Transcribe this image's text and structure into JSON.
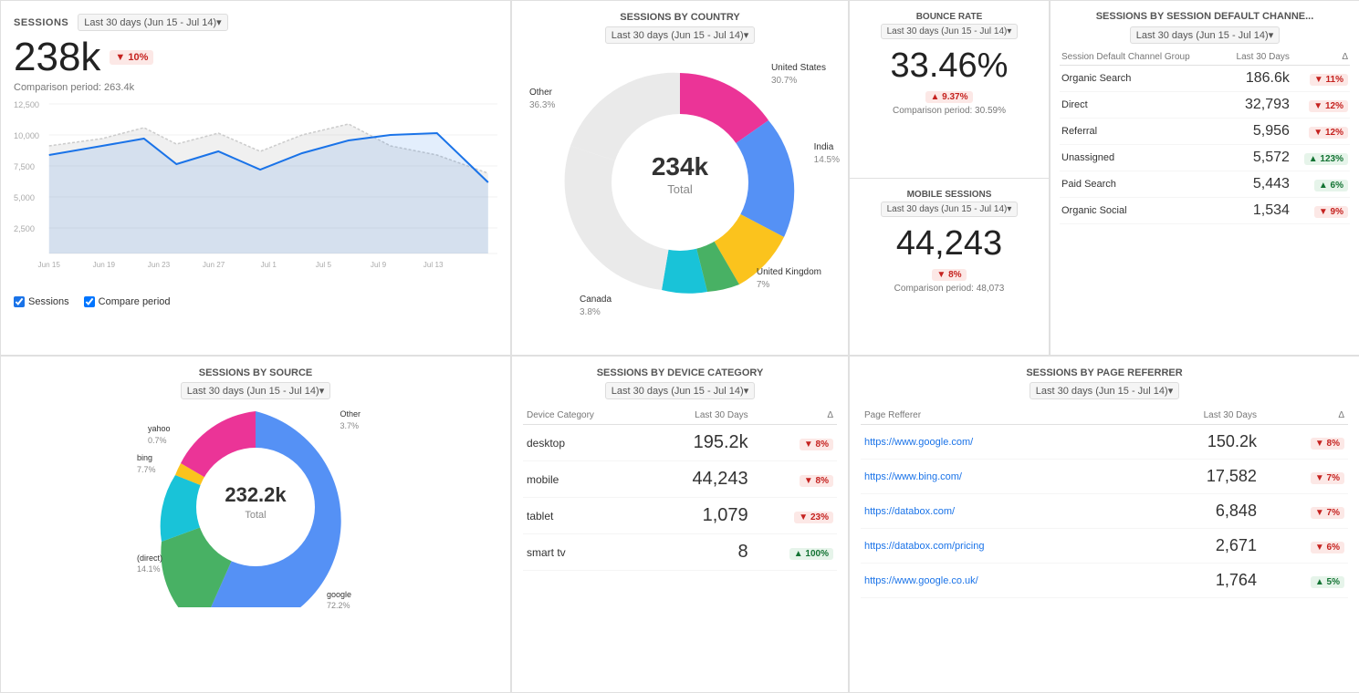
{
  "sessions": {
    "title": "SESSIONS",
    "dateFilter": "Last 30 days (Jun 15 - Jul 14)",
    "value": "238k",
    "changeBadge": "▼ 10%",
    "comparison": "Comparison period: 263.4k",
    "legend": {
      "sessions": "Sessions",
      "comparePeriod": "Compare period"
    },
    "yAxis": [
      "12,500",
      "10,000",
      "7,500",
      "5,000",
      "2,500"
    ],
    "xAxis": [
      "Jun 15",
      "Jun 19",
      "Jun 23",
      "Jun 27",
      "Jul 1",
      "Jul 5",
      "Jul 9",
      "Jul 13"
    ]
  },
  "sessionsByCountry": {
    "title": "SESSIONS BY COUNTRY",
    "dateFilter": "Last 30 days (Jun 15 - Jul 14)",
    "total": "234k",
    "totalLabel": "Total",
    "segments": [
      {
        "label": "United States",
        "value": "30.7%",
        "color": "#4285f4"
      },
      {
        "label": "India",
        "value": "14.5%",
        "color": "#34a853"
      },
      {
        "label": "United Kingdom",
        "value": "7%",
        "color": "#fbbc04"
      },
      {
        "label": "Canada",
        "value": "3.8%",
        "color": "#ea4335"
      },
      {
        "label": "Other",
        "value": "36.3%",
        "color": "#e91e8c"
      }
    ]
  },
  "bounceRate": {
    "title": "BOUNCE RATE",
    "dateFilter": "Last 30 days (Jun 15 - Jul 14)",
    "value": "33.46%",
    "changeBadge": "▲ 9.37%",
    "changeType": "up-bad",
    "comparison": "Comparison period: 30.59%"
  },
  "mobileSessions": {
    "title": "MOBILE SESSIONS",
    "dateFilter": "Last 30 days (Jun 15 - Jul 14)",
    "value": "44,243",
    "changeBadge": "▼ 8%",
    "changeType": "down-bad",
    "comparison": "Comparison period: 48,073"
  },
  "sessionsByChannel": {
    "title": "SESSIONS BY SESSION DEFAULT CHANNE...",
    "dateFilter": "Last 30 days (Jun 15 - Jul 14)",
    "colHeader1": "Session Default Channel Group",
    "colHeader2": "Last 30 Days",
    "colHeader3": "Δ",
    "rows": [
      {
        "label": "Organic Search",
        "value": "186.6k",
        "delta": "▼ 11%",
        "deltaType": "bad"
      },
      {
        "label": "Direct",
        "value": "32,793",
        "delta": "▼ 12%",
        "deltaType": "bad"
      },
      {
        "label": "Referral",
        "value": "5,956",
        "delta": "▼ 12%",
        "deltaType": "bad"
      },
      {
        "label": "Unassigned",
        "value": "5,572",
        "delta": "▲ 123%",
        "deltaType": "good"
      },
      {
        "label": "Paid Search",
        "value": "5,443",
        "delta": "▲ 6%",
        "deltaType": "good"
      },
      {
        "label": "Organic Social",
        "value": "1,534",
        "delta": "▼ 9%",
        "deltaType": "bad"
      }
    ]
  },
  "sessionsBySource": {
    "title": "SESSIONS BY SOURCE",
    "dateFilter": "Last 30 days (Jun 15 - Jul 14)",
    "total": "232.2k",
    "totalLabel": "Total",
    "segments": [
      {
        "label": "google",
        "value": "72.2%",
        "color": "#4285f4"
      },
      {
        "label": "(direct)",
        "value": "14.1%",
        "color": "#34a853"
      },
      {
        "label": "bing",
        "value": "7.7%",
        "color": "#00bcd4"
      },
      {
        "label": "yahoo",
        "value": "0.7%",
        "color": "#fbbc04"
      },
      {
        "label": "Other",
        "value": "3.7%",
        "color": "#e91e8c"
      }
    ]
  },
  "sessionsByDevice": {
    "title": "SESSIONS BY DEVICE CATEGORY",
    "dateFilter": "Last 30 days (Jun 15 - Jul 14)",
    "colHeader1": "Device Category",
    "colHeader2": "Last 30 Days",
    "colHeader3": "Δ",
    "rows": [
      {
        "label": "desktop",
        "value": "195.2k",
        "delta": "▼ 8%",
        "deltaType": "bad"
      },
      {
        "label": "mobile",
        "value": "44,243",
        "delta": "▼ 8%",
        "deltaType": "bad"
      },
      {
        "label": "tablet",
        "value": "1,079",
        "delta": "▼ 23%",
        "deltaType": "bad"
      },
      {
        "label": "smart tv",
        "value": "8",
        "delta": "▲ 100%",
        "deltaType": "good"
      }
    ]
  },
  "sessionsByReferrer": {
    "title": "SESSIONS BY PAGE REFERRER",
    "dateFilter": "Last 30 days (Jun 15 - Jul 14)",
    "colHeader1": "Page Refferer",
    "colHeader2": "Last 30 Days",
    "colHeader3": "Δ",
    "rows": [
      {
        "label": "https://www.google.com/",
        "value": "150.2k",
        "delta": "▼ 8%",
        "deltaType": "bad"
      },
      {
        "label": "https://www.bing.com/",
        "value": "17,582",
        "delta": "▼ 7%",
        "deltaType": "bad"
      },
      {
        "label": "https://databox.com/",
        "value": "6,848",
        "delta": "▼ 7%",
        "deltaType": "bad"
      },
      {
        "label": "https://databox.com/pricing",
        "value": "2,671",
        "delta": "▼ 6%",
        "deltaType": "bad"
      },
      {
        "label": "https://www.google.co.uk/",
        "value": "1,764",
        "delta": "▲ 5%",
        "deltaType": "good"
      }
    ]
  }
}
